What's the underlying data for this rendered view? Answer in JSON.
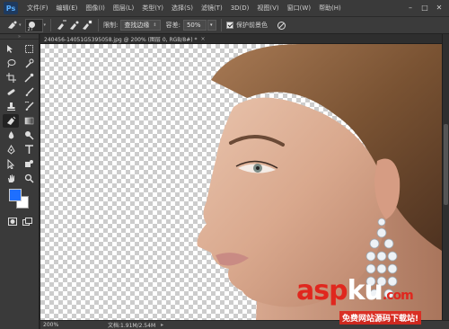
{
  "app": {
    "logo": "Ps",
    "menu": [
      "文件(F)",
      "编辑(E)",
      "图像(I)",
      "图层(L)",
      "类型(Y)",
      "选择(S)",
      "滤镜(T)",
      "3D(D)",
      "视图(V)",
      "窗口(W)",
      "帮助(H)"
    ],
    "window_controls": [
      "–",
      "□",
      "✕"
    ]
  },
  "options": {
    "brush_size": "27",
    "limit_label": "限制:",
    "limit_value": "查找边缘",
    "tolerance_label": "容差:",
    "tolerance_value": "50%",
    "protect_fg_label": "保护前景色",
    "protect_fg_checked": true
  },
  "document": {
    "tab_title": "240456-14051G5395058.jpg @ 200% (图层 0, RGB/8#) *",
    "tab_close": "×",
    "zoom": "200%",
    "doc_info": "文档:1.91M/2.54M",
    "more_arrow": "▸"
  },
  "colors": {
    "foreground": "#1e6fff",
    "background": "#ffffff"
  },
  "tools": [
    "move-icon",
    "marquee-icon",
    "lasso-icon",
    "quick-select-icon",
    "crop-icon",
    "eyedropper-icon",
    "healing-icon",
    "brush-icon",
    "clone-stamp-icon",
    "history-brush-icon",
    "background-eraser-icon",
    "gradient-icon",
    "blur-icon",
    "dodge-icon",
    "pen-icon",
    "type-icon",
    "path-select-icon",
    "shape-icon",
    "hand-icon",
    "zoom-icon"
  ],
  "watermark": {
    "main_red1": "asp",
    "main_white": "ku",
    "main_red2": ".com",
    "sub": "免费网站源码下载站!"
  }
}
